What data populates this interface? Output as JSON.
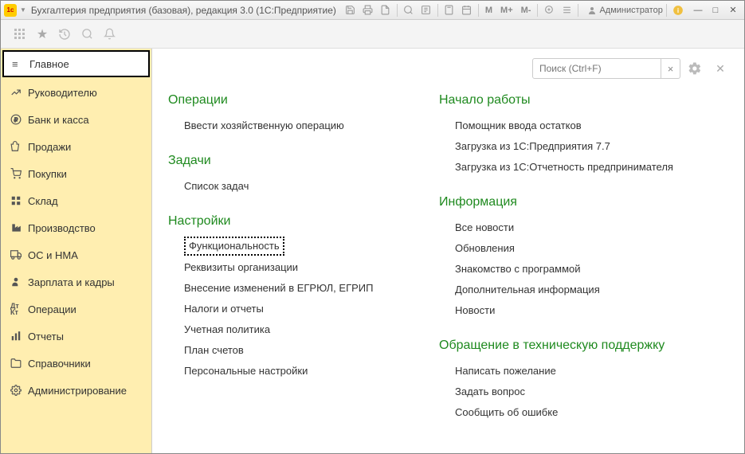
{
  "title": "Бухгалтерия предприятия (базовая), редакция 3.0  (1С:Предприятие)",
  "admin": "Администратор",
  "mem": {
    "m": "M",
    "mplus": "M+",
    "mminus": "M-"
  },
  "search": {
    "placeholder": "Поиск (Ctrl+F)"
  },
  "sidebar": {
    "items": [
      {
        "label": "Главное"
      },
      {
        "label": "Руководителю"
      },
      {
        "label": "Банк и касса"
      },
      {
        "label": "Продажи"
      },
      {
        "label": "Покупки"
      },
      {
        "label": "Склад"
      },
      {
        "label": "Производство"
      },
      {
        "label": "ОС и НМА"
      },
      {
        "label": "Зарплата и кадры"
      },
      {
        "label": "Операции"
      },
      {
        "label": "Отчеты"
      },
      {
        "label": "Справочники"
      },
      {
        "label": "Администрирование"
      }
    ]
  },
  "col1": {
    "sec1": {
      "title": "Операции",
      "items": [
        "Ввести хозяйственную операцию"
      ]
    },
    "sec2": {
      "title": "Задачи",
      "items": [
        "Список задач"
      ]
    },
    "sec3": {
      "title": "Настройки",
      "items": [
        "Функциональность",
        "Реквизиты организации",
        "Внесение изменений в ЕГРЮЛ, ЕГРИП",
        "Налоги и отчеты",
        "Учетная политика",
        "План счетов",
        "Персональные настройки"
      ]
    }
  },
  "col2": {
    "sec1": {
      "title": "Начало работы",
      "items": [
        "Помощник ввода остатков",
        "Загрузка из 1С:Предприятия 7.7",
        "Загрузка из 1С:Отчетность предпринимателя"
      ]
    },
    "sec2": {
      "title": "Информация",
      "items": [
        "Все новости",
        "Обновления",
        "Знакомство с программой",
        "Дополнительная информация",
        "Новости"
      ]
    },
    "sec3": {
      "title": "Обращение в техническую поддержку",
      "items": [
        "Написать пожелание",
        "Задать вопрос",
        "Сообщить об ошибке"
      ]
    }
  }
}
